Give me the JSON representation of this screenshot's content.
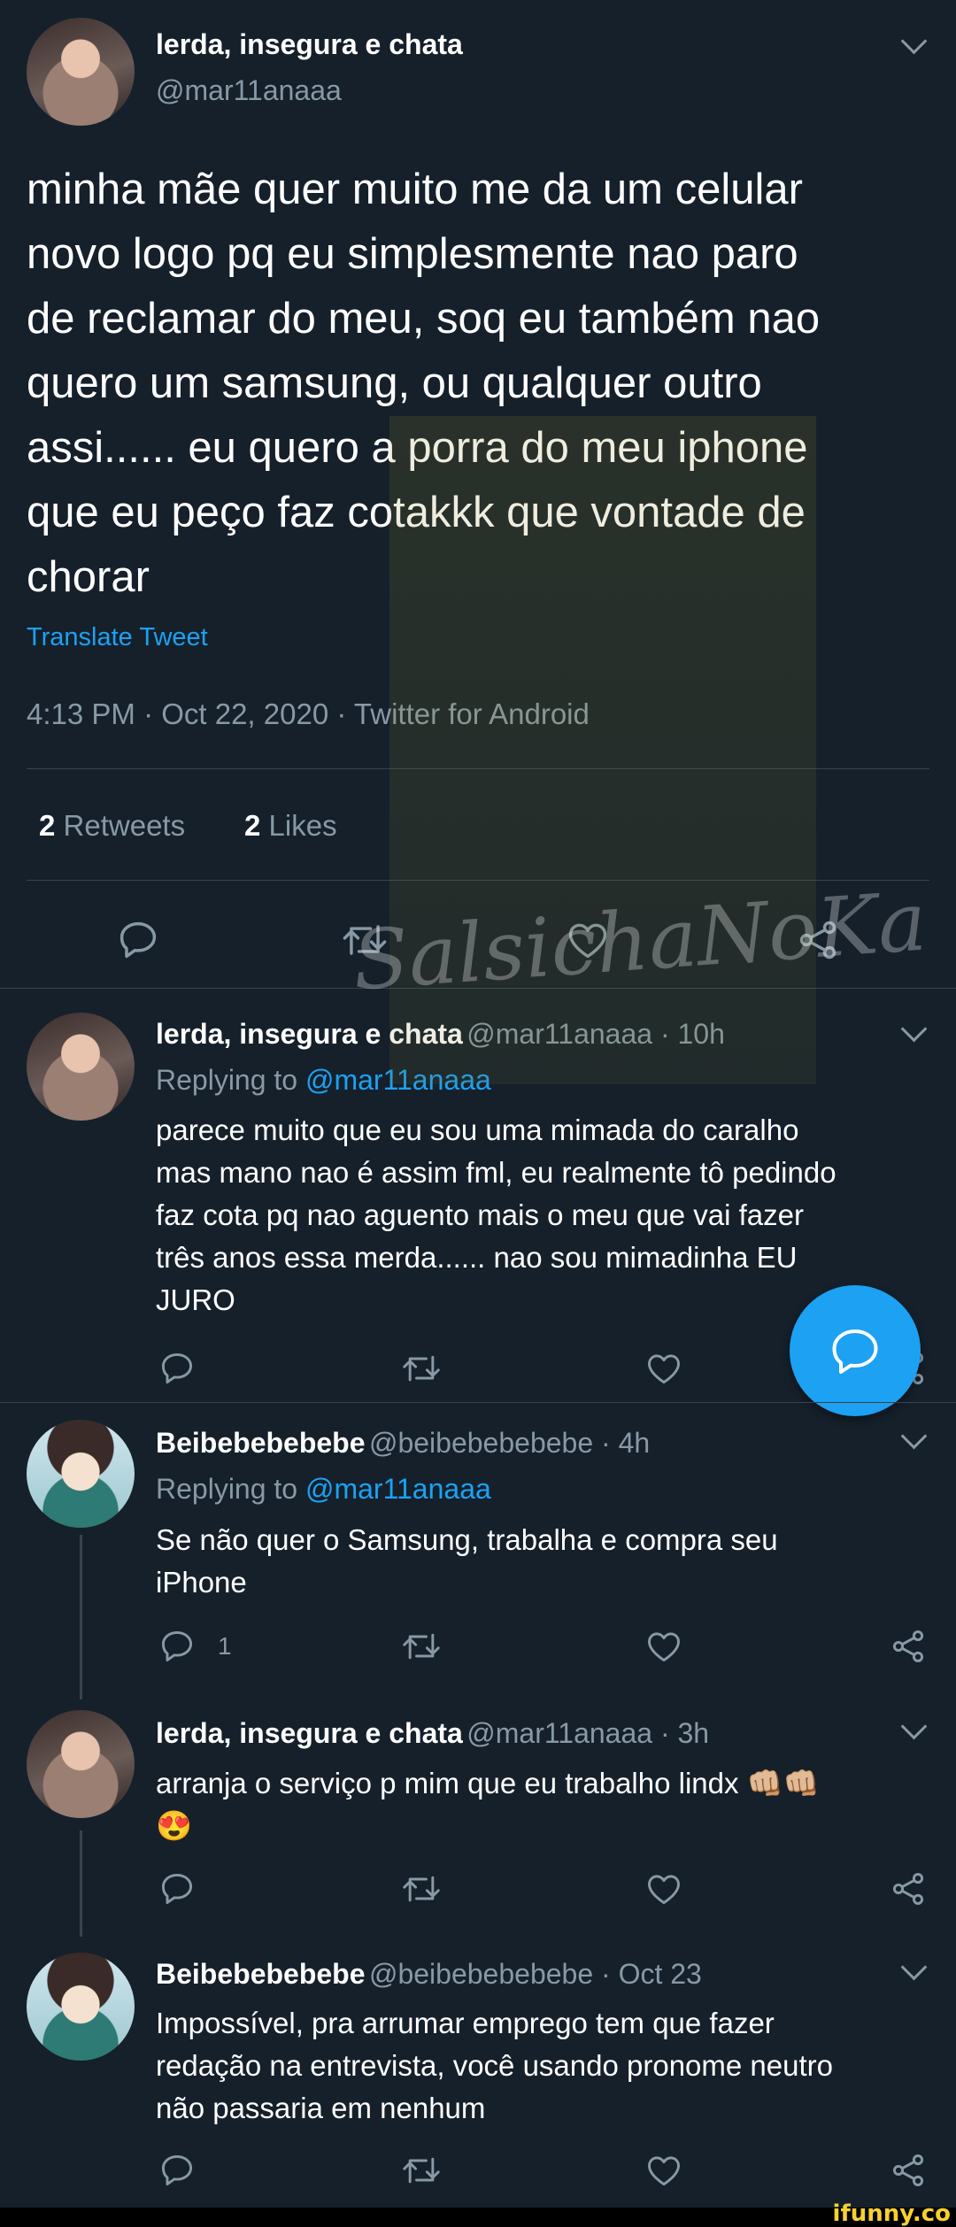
{
  "main_tweet": {
    "display_name": "lerda, insegura e chata",
    "handle": "@mar11anaaa",
    "text_lines": [
      "minha mãe quer muito me da um celular",
      "novo logo pq eu simplesmente nao paro",
      "de reclamar do meu, soq eu também nao",
      "quero um samsung, ou qualquer outro",
      "assi...... eu quero a porra do meu iphone",
      "que eu peço faz cotakkk que vontade de",
      "chorar"
    ],
    "translate_label": "Translate Tweet",
    "timestamp": "4:13 PM · Oct 22, 2020 · Twitter for Android",
    "retweets_count": "2",
    "retweets_label": "Retweets",
    "likes_count": "2",
    "likes_label": "Likes"
  },
  "watermark": "SalsichaNoKa",
  "replies": [
    {
      "display_name": "lerda, insegura e chata",
      "handle_time": "@mar11anaaa · 10h",
      "replying_prefix": "Replying to",
      "replying_handle": "@mar11anaaa",
      "text_lines": [
        "parece muito que eu sou uma mimada do caralho",
        "mas mano nao é assim fml, eu realmente tô pedindo",
        "faz cota pq nao aguento mais o meu que vai fazer",
        "três anos essa merda...... nao sou mimadinha EU",
        "JURO"
      ],
      "reply_count": ""
    },
    {
      "display_name": "Beibebebebebe",
      "handle_time": "@beibebebebebe · 4h",
      "replying_prefix": "Replying to",
      "replying_handle": "@mar11anaaa",
      "text_lines": [
        "Se não quer o Samsung, trabalha e compra seu",
        "iPhone"
      ],
      "reply_count": "1"
    },
    {
      "display_name": "lerda, insegura e chata",
      "handle_time": "@mar11anaaa · 3h",
      "text_lines": [
        "arranja o serviço p mim que eu trabalho lindx 👊🏼👊🏼",
        "😍"
      ],
      "reply_count": ""
    },
    {
      "display_name": "Beibebebebebe",
      "handle_time": "@beibebebebebe · Oct 23",
      "text_lines": [
        "Impossível, pra arrumar emprego tem que fazer",
        "redação na entrevista, você usando pronome neutro",
        "não passaria em nenhum"
      ],
      "reply_count": ""
    }
  ],
  "footer_brand": "ifunny.co",
  "colors": {
    "background": "#15202b",
    "accent": "#1da1f2",
    "secondary_text": "#8899a6",
    "divider": "#38444d"
  }
}
